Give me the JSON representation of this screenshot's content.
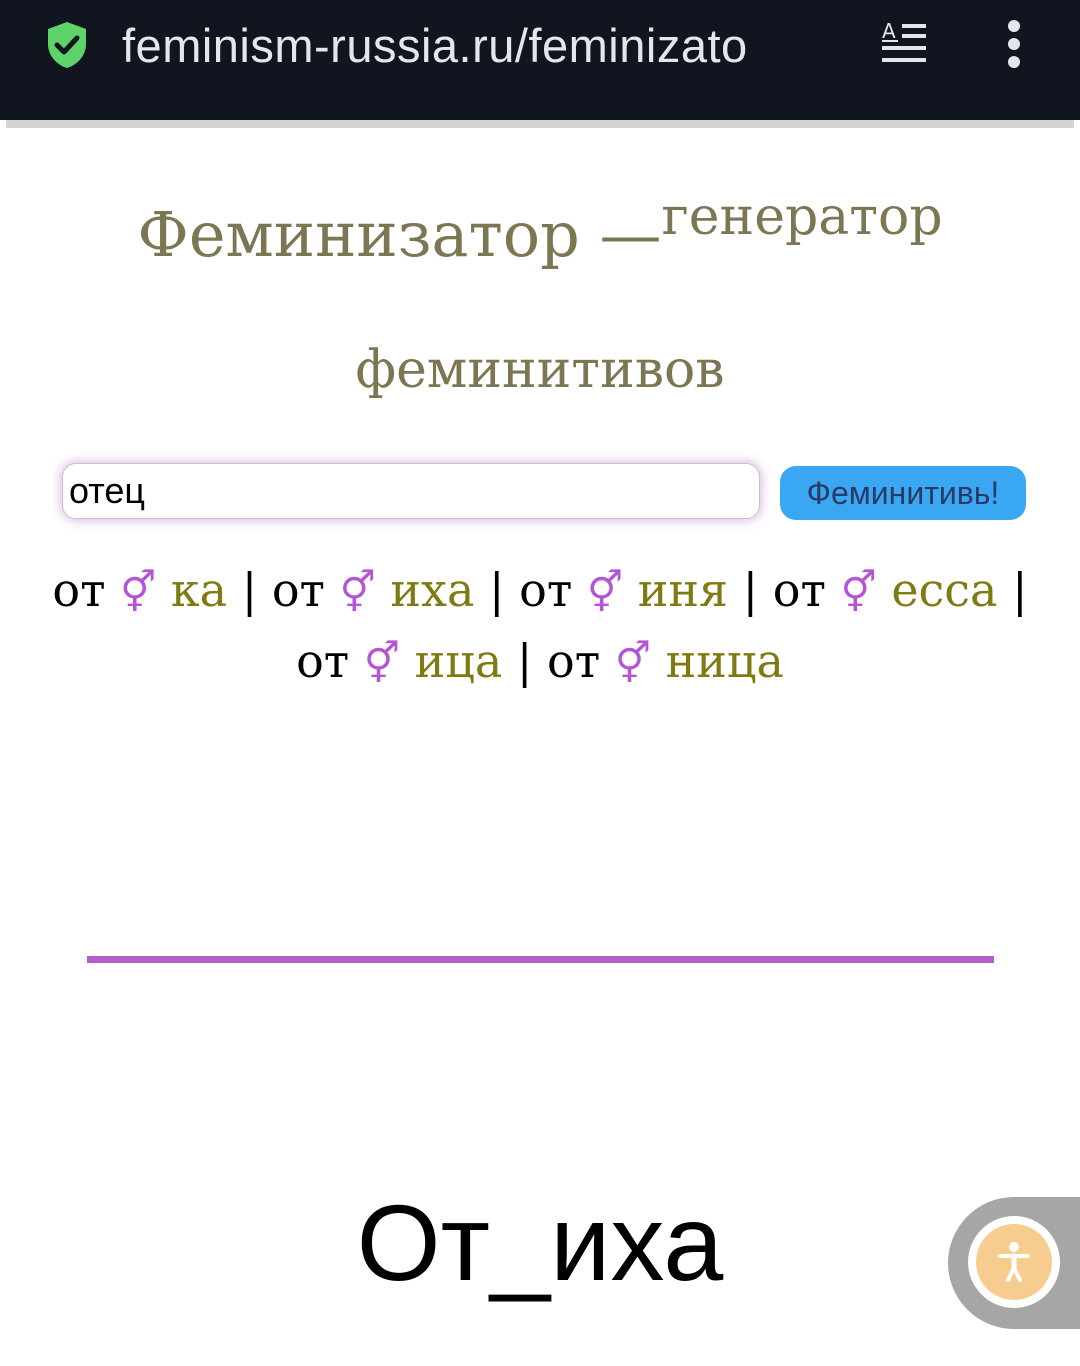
{
  "browser": {
    "url": "feminism-russia.ru/feminizato",
    "shield_color": "#5ed36a",
    "icons": [
      "shield-check-icon",
      "reader-mode-icon",
      "more-vertical-icon"
    ]
  },
  "page": {
    "title_main": "Феминизатор —",
    "title_sup": "генератор",
    "title_line2": "феминитивов",
    "input_value": "отец",
    "button_label": "Феминитивь!",
    "results": [
      {
        "stem": "от",
        "symbol": "⚥",
        "suffix": "ка"
      },
      {
        "stem": "от",
        "symbol": "⚥",
        "suffix": "иха"
      },
      {
        "stem": "от",
        "symbol": "⚥",
        "suffix": "иня"
      },
      {
        "stem": "от",
        "symbol": "⚥",
        "suffix": "есса"
      },
      {
        "stem": "от",
        "symbol": "⚥",
        "suffix": "ица"
      },
      {
        "stem": "от",
        "symbol": "⚥",
        "suffix": "ница"
      }
    ],
    "separator": "|",
    "big_result": "От_иха",
    "colors": {
      "title": "#7c7653",
      "suffix": "#7f7a12",
      "symbol": "#b455d4",
      "divider": "#b65dcc",
      "button": "#3aa7f2"
    }
  },
  "accessibility": {
    "icon": "accessibility-person-icon"
  }
}
